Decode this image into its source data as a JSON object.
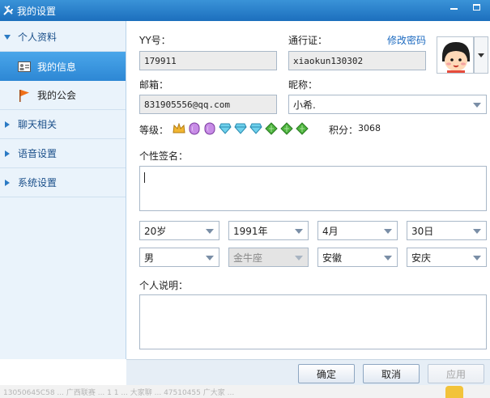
{
  "window": {
    "title": "我的设置"
  },
  "sidebar": {
    "sections": [
      {
        "label": "个人资料",
        "expanded": true
      },
      {
        "label": "聊天相关",
        "expanded": false
      },
      {
        "label": "语音设置",
        "expanded": false
      },
      {
        "label": "系统设置",
        "expanded": false
      }
    ],
    "subitems": [
      {
        "label": "我的信息",
        "active": true,
        "icon": "id-card-icon"
      },
      {
        "label": "我的公会",
        "active": false,
        "icon": "flag-icon"
      }
    ]
  },
  "profile": {
    "yy_label": "YY号：",
    "yy_value": "179911",
    "passport_label": "通行证：",
    "passport_value": "xiaokun130302",
    "change_password": "修改密码",
    "email_label": "邮箱：",
    "email_value": "831905556@qq.com",
    "nickname_label": "昵称：",
    "nickname_value": "小希.",
    "level_label": "等级：",
    "level_icons": [
      "crown-icon",
      "moon-icon",
      "moon-icon",
      "diamond-icon",
      "diamond-icon",
      "diamond-icon",
      "leaf-icon",
      "leaf-icon",
      "leaf-icon"
    ],
    "points_label": "积分：",
    "points_value": "3068",
    "signature_label": "个性签名：",
    "age": "20岁",
    "birth_year": "1991年",
    "birth_month": "4月",
    "birth_day": "30日",
    "gender": "男",
    "zodiac": "金牛座",
    "province": "安徽",
    "city": "安庆",
    "description_label": "个人说明："
  },
  "buttons": {
    "ok": "确定",
    "cancel": "取消",
    "apply": "应用"
  },
  "background_strip": "13050645C58 ... 广西联赛 ... 1 1 ... 大家聊 ... 47510455 广大家 ... ",
  "colors": {
    "accent": "#2d87d4",
    "titlebar": "#1c6fbd",
    "link": "#1d6bc0"
  }
}
